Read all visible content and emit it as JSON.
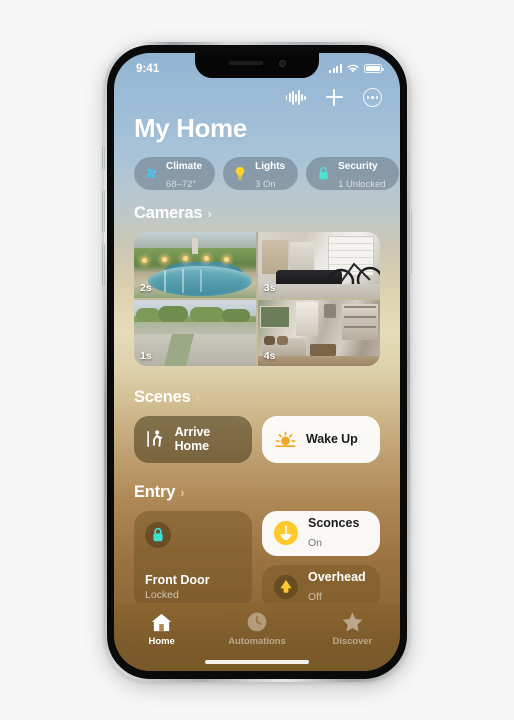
{
  "status_bar": {
    "time": "9:41",
    "cellular_icon": "signal-bars-icon",
    "wifi_icon": "wifi-icon",
    "battery_icon": "battery-icon"
  },
  "toolbar": {
    "siri_waveform_icon": "waveform-icon",
    "add_icon": "plus-icon",
    "more_icon": "ellipsis-circle-icon"
  },
  "header": {
    "title": "My Home"
  },
  "status_chips": [
    {
      "title": "Climate",
      "subtitle": "68–72°",
      "icon": "fan-icon",
      "color": "#45c8f0"
    },
    {
      "title": "Lights",
      "subtitle": "3 On",
      "icon": "lightbulb-icon",
      "color": "#ffd426"
    },
    {
      "title": "Security",
      "subtitle": "1 Unlocked",
      "icon": "lock-icon",
      "color": "#4fe0cf"
    },
    {
      "title": "",
      "subtitle": "",
      "icon": "partial-chip",
      "color": "#9fb7cb"
    }
  ],
  "sections": {
    "cameras": {
      "title": "Cameras",
      "chevron": "›",
      "tiles": [
        {
          "name": "Pool Camera",
          "label": "2s",
          "art": "cam-pool"
        },
        {
          "name": "Garage Camera",
          "label": "3s",
          "art": "cam-garage"
        },
        {
          "name": "Driveway Camera",
          "label": "1s",
          "art": "cam-drive"
        },
        {
          "name": "Living Room Camera",
          "label": "4s",
          "art": "cam-living"
        }
      ]
    },
    "scenes": {
      "title": "Scenes",
      "chevron": "›",
      "tiles": [
        {
          "label": "Arrive Home",
          "icon": "walking-person-icon",
          "style": "dark"
        },
        {
          "label": "Wake Up",
          "icon": "sunrise-icon",
          "style": "light"
        }
      ]
    },
    "entry": {
      "title": "Entry",
      "chevron": "›",
      "front_door": {
        "name": "Front Door",
        "state": "Locked",
        "icon": "lock-closed-icon",
        "icon_color": "#3fe0d0"
      },
      "accessories": [
        {
          "name": "Sconces",
          "state": "On",
          "icon": "sconce-lamp-icon",
          "style": "light"
        },
        {
          "name": "Overhead",
          "state": "Off",
          "icon": "ceiling-light-icon",
          "style": "warm"
        }
      ]
    }
  },
  "tab_bar": [
    {
      "label": "Home",
      "icon": "house-icon",
      "active": true
    },
    {
      "label": "Automations",
      "icon": "clock-icon",
      "active": false
    },
    {
      "label": "Discover",
      "icon": "star-icon",
      "active": false
    }
  ]
}
